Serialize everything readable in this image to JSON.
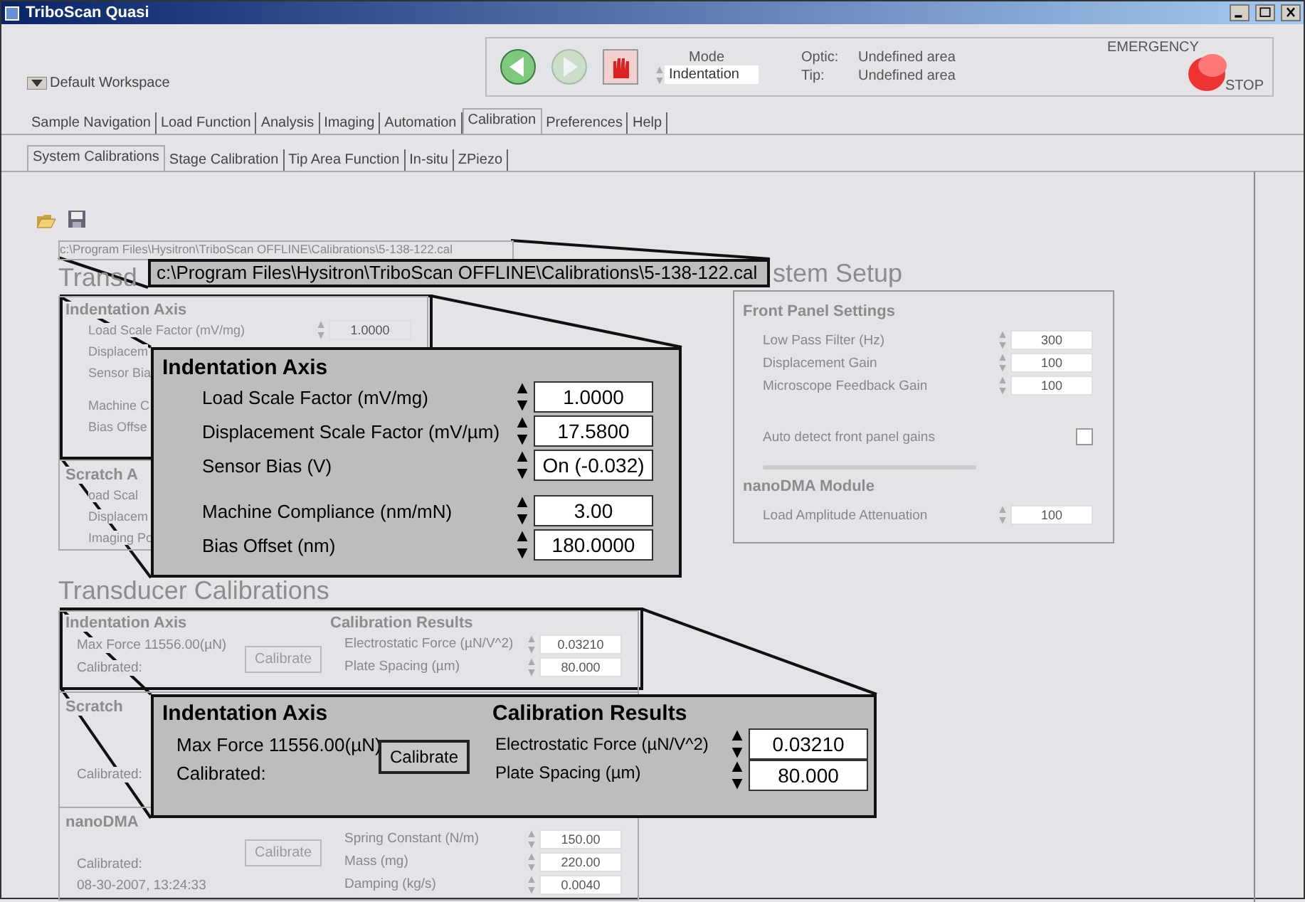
{
  "window": {
    "title": "TriboScan Quasi"
  },
  "workspace": {
    "label": "Default Workspace"
  },
  "nav_buttons": [
    {
      "kind": "back",
      "disabled": false
    },
    {
      "kind": "forward",
      "disabled": true
    },
    {
      "kind": "stop",
      "disabled": false
    }
  ],
  "mode": {
    "label": "Mode",
    "value": "Indentation"
  },
  "status": [
    {
      "label": "Optic:",
      "value": "Undefined area"
    },
    {
      "label": "Tip:",
      "value": "Undefined area"
    }
  ],
  "emergency": {
    "top": "EMERGENCY",
    "bottom": "STOP"
  },
  "tabs": [
    {
      "label": "Sample Navigation",
      "selected": false
    },
    {
      "label": "Load Function",
      "selected": false
    },
    {
      "label": "Analysis",
      "selected": false
    },
    {
      "label": "Imaging",
      "selected": false
    },
    {
      "label": "Automation",
      "selected": false
    },
    {
      "label": "Calibration",
      "selected": true
    },
    {
      "label": "Preferences",
      "selected": false
    },
    {
      "label": "Help",
      "selected": false
    }
  ],
  "subtabs": [
    {
      "label": "System Calibrations",
      "selected": true
    },
    {
      "label": "Stage Calibration",
      "selected": false
    },
    {
      "label": "Tip Area Function",
      "selected": false
    },
    {
      "label": "In-situ",
      "selected": false
    },
    {
      "label": "ZPiezo",
      "selected": false
    }
  ],
  "file_path": "c:\\Program Files\\Hysitron\\TriboScan OFFLINE\\Calibrations\\5-138-122.cal",
  "file_path_magnified": "c:\\Program Files\\Hysitron\\TriboScan OFFLINE\\Calibrations\\5-138-122.cal",
  "transducer_setup": {
    "heading": "Transd",
    "indentation": {
      "title": "Indentation Axis",
      "rows": [
        {
          "label": "Load Scale Factor  (mV/mg)",
          "value": "1.0000"
        },
        {
          "label": "Displacem"
        },
        {
          "label": "Sensor Bia"
        }
      ],
      "rows_2": [
        {
          "label": "Machine C"
        },
        {
          "label": "Bias Offse"
        }
      ]
    },
    "scratch": {
      "title": "Scratch A",
      "rows": [
        {
          "label": "oad Scal"
        },
        {
          "label": "Displacem"
        },
        {
          "label": "Imaging Po"
        }
      ]
    }
  },
  "magnifier_1": {
    "title": "Indentation  Axis",
    "rows": [
      {
        "label": "Load Scale Factor   (mV/mg)",
        "value": "1.0000"
      },
      {
        "label": "Displacement Scale Factor (mV/µm)",
        "value": "17.5800"
      },
      {
        "label": "Sensor Bias (V)",
        "value": "On (-0.032)"
      }
    ],
    "rows_2": [
      {
        "label": "Machine Compliance (nm/mN)",
        "value": "3.00"
      },
      {
        "label": "Bias Offset (nm)",
        "value": "180.0000"
      }
    ]
  },
  "system_setup": {
    "heading": "stem Setup",
    "front_panel": {
      "title": "Front Panel Settings",
      "rows": [
        {
          "label": "Low Pass Filter (Hz)",
          "value": "300"
        },
        {
          "label": "Displacement Gain",
          "value": "100"
        },
        {
          "label": "Microscope Feedback Gain",
          "value": "100"
        }
      ],
      "checkbox": {
        "label": "Auto detect front panel gains",
        "checked": false
      }
    },
    "nanodma": {
      "title": "nanoDMA Module",
      "rows": [
        {
          "label": "Load Amplitude Attenuation",
          "value": "100"
        }
      ]
    }
  },
  "transducer_calibrations": {
    "heading": "Transducer Calibrations",
    "indentation": {
      "title": "Indentation  Axis",
      "max_force": "Max Force  11556.00(µN)",
      "calibrated": "Calibrated:",
      "button": "Calibrate",
      "results_title": "Calibration Results",
      "results": [
        {
          "label": "Electrostatic Force (µN/V^2)",
          "value": "0.03210"
        },
        {
          "label": "Plate Spacing (µm)",
          "value": "80.000"
        }
      ]
    },
    "scratch": {
      "title": "Scratch",
      "calibrated": "Calibrated:"
    },
    "nanodma": {
      "title": "nanoDMA",
      "button": "Calibrate",
      "calibrated": "Calibrated:",
      "date": "08-30-2007, 13:24:33",
      "results": [
        {
          "label": "Spring Constant (N/m)",
          "value": "150.00"
        },
        {
          "label": "Mass (mg)",
          "value": "220.00"
        },
        {
          "label": "Damping (kg/s)",
          "value": "0.0040"
        }
      ]
    }
  },
  "magnifier_2": {
    "title": "Indentation  Axis",
    "max_force": "Max Force  11556.00(µN)",
    "calibrated": "Calibrated:",
    "button": "Calibrate",
    "results_title": "Calibration Results",
    "results": [
      {
        "label": "Electrostatic Force (µN/V^2)",
        "value": "0.03210"
      },
      {
        "label": "Plate Spacing (µm)",
        "value": "80.000"
      }
    ]
  }
}
